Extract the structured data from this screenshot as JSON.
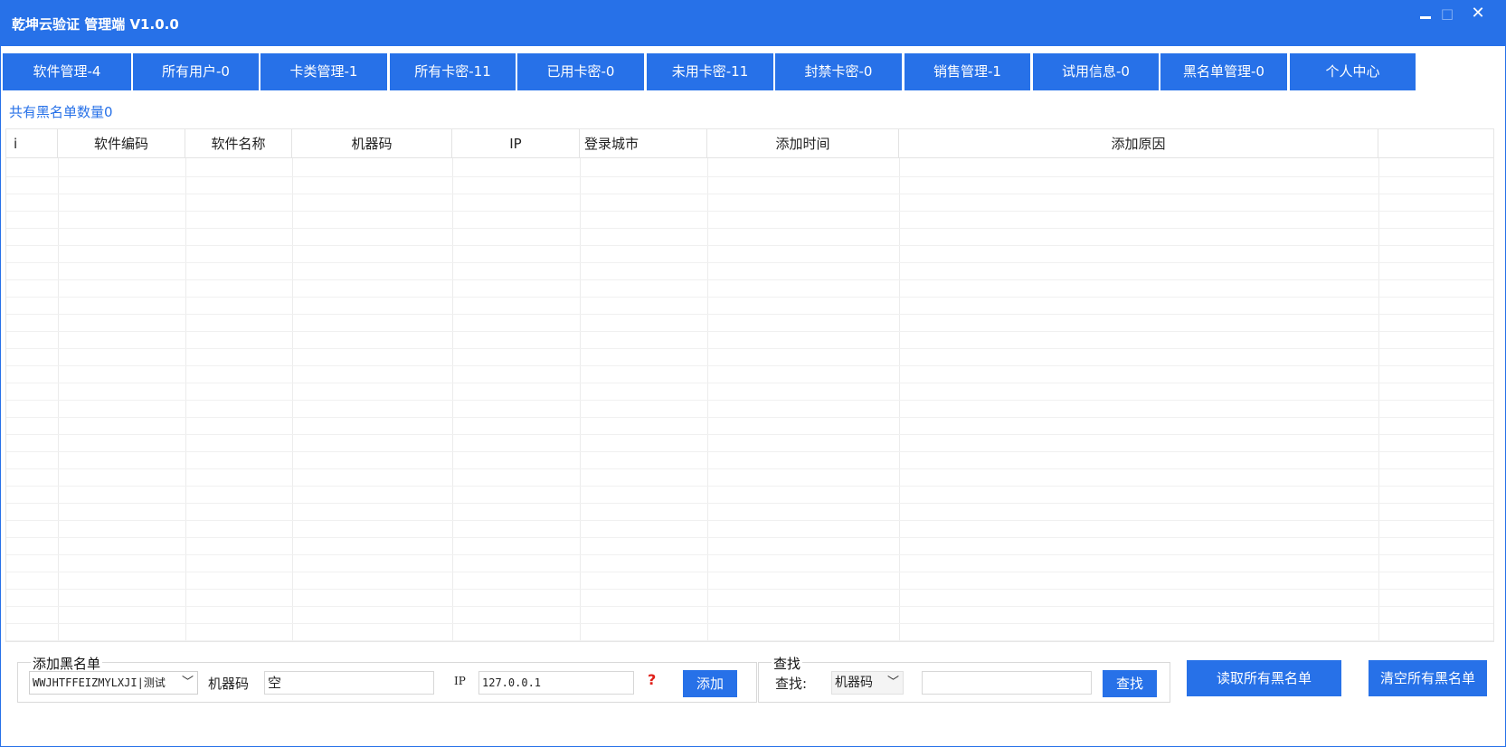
{
  "titlebar": {
    "title": "乾坤云验证 管理端 V1.0.0",
    "max_glyph": "□",
    "close_glyph": "✕"
  },
  "tabs": [
    {
      "label": "软件管理-4"
    },
    {
      "label": "所有用户-0"
    },
    {
      "label": "卡类管理-1"
    },
    {
      "label": "所有卡密-11"
    },
    {
      "label": "已用卡密-0"
    },
    {
      "label": "未用卡密-11"
    },
    {
      "label": "封禁卡密-0"
    },
    {
      "label": "销售管理-1"
    },
    {
      "label": "试用信息-0"
    },
    {
      "label": "黑名单管理-0"
    },
    {
      "label": "个人中心"
    }
  ],
  "summary": {
    "count_label": "共有黑名单数量0"
  },
  "table": {
    "columns": [
      "i",
      "软件编码",
      "软件名称",
      "机器码",
      "IP",
      "登录城市",
      "添加时间",
      "添加原因",
      ""
    ],
    "rows": []
  },
  "add_panel": {
    "title": "添加黑名单",
    "software_select": "WWJHTFFEIZMYLXJI|测试",
    "machine_label": "机器码",
    "machine_value": "空",
    "ip_label": "IP",
    "ip_value": "127.0.0.1",
    "help_glyph": "?",
    "add_button": "添加"
  },
  "find_panel": {
    "title": "查找",
    "find_label": "查找:",
    "field_select": "机器码",
    "query_value": "",
    "find_button": "查找"
  },
  "actions": {
    "read_all": "读取所有黑名单",
    "clear_all": "清空所有黑名单"
  },
  "colors": {
    "accent": "#2771e8",
    "help": "#e0201a"
  }
}
